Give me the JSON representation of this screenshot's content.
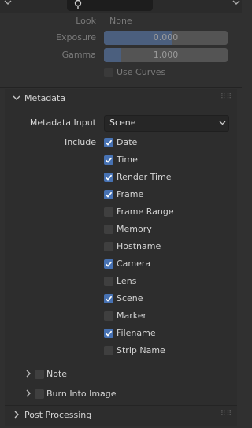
{
  "color_management": {
    "look": {
      "label": "Look",
      "value": "None"
    },
    "exposure": {
      "label": "Exposure",
      "value": "0.000",
      "fraction": 0.55
    },
    "gamma": {
      "label": "Gamma",
      "value": "1.000",
      "fraction": 0.14
    },
    "use_curves": {
      "label": "Use Curves",
      "checked": false
    }
  },
  "metadata": {
    "title": "Metadata",
    "input_label": "Metadata Input",
    "input_value": "Scene",
    "include_label": "Include",
    "items": [
      {
        "label": "Date",
        "checked": true
      },
      {
        "label": "Time",
        "checked": true
      },
      {
        "label": "Render Time",
        "checked": true
      },
      {
        "label": "Frame",
        "checked": true
      },
      {
        "label": "Frame Range",
        "checked": false
      },
      {
        "label": "Memory",
        "checked": false
      },
      {
        "label": "Hostname",
        "checked": false
      },
      {
        "label": "Camera",
        "checked": true
      },
      {
        "label": "Lens",
        "checked": false
      },
      {
        "label": "Scene",
        "checked": true
      },
      {
        "label": "Marker",
        "checked": false
      },
      {
        "label": "Filename",
        "checked": true
      },
      {
        "label": "Strip Name",
        "checked": false
      }
    ],
    "note": {
      "label": "Note",
      "checked": false
    },
    "burn_into_image": {
      "label": "Burn Into Image",
      "checked": false
    }
  },
  "post_processing": {
    "title": "Post Processing"
  },
  "icons": {
    "search": "search-icon",
    "expand": "chevron-down-icon",
    "collapse": "chevron-right-icon",
    "grip": "drag-handle-icon",
    "check": "checkmark-icon"
  },
  "colors": {
    "accent": "#4772b3",
    "panel": "#2d2d2d",
    "background": "#303030"
  }
}
